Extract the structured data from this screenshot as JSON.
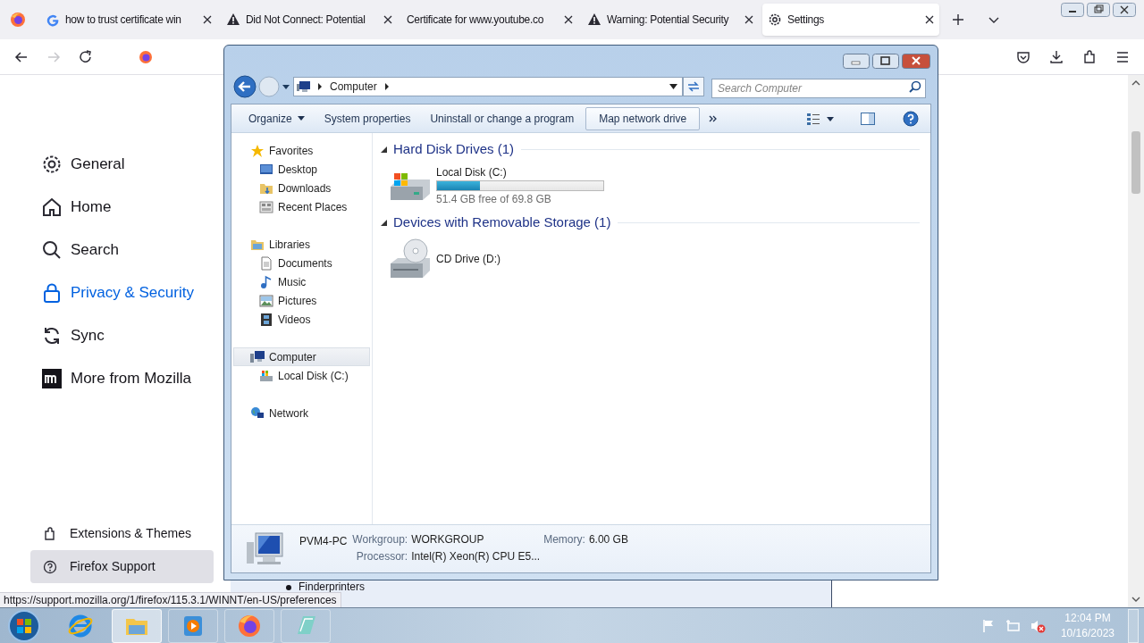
{
  "browser": {
    "tabs": [
      {
        "title": "how to trust certificate win",
        "kind": "google",
        "selected": false
      },
      {
        "title": "Did Not Connect: Potential",
        "kind": "warning",
        "selected": false
      },
      {
        "title": "Certificate for www.youtube.co",
        "kind": "plain",
        "selected": false
      },
      {
        "title": "Warning: Potential Security",
        "kind": "warning",
        "selected": false
      },
      {
        "title": "Settings",
        "kind": "gear",
        "selected": true
      }
    ],
    "nav_buttons": [
      {
        "kind": "back",
        "disabled": false
      },
      {
        "kind": "forward",
        "disabled": true
      },
      {
        "kind": "reload",
        "disabled": false
      }
    ]
  },
  "settings": {
    "categories": [
      {
        "label": "General",
        "kind": "gear",
        "selected": false
      },
      {
        "label": "Home",
        "kind": "home",
        "selected": false
      },
      {
        "label": "Search",
        "kind": "search",
        "selected": false
      },
      {
        "label": "Privacy & Security",
        "kind": "lock",
        "selected": true
      },
      {
        "label": "Sync",
        "kind": "sync",
        "selected": false
      },
      {
        "label": "More from Mozilla",
        "kind": "mozilla",
        "selected": false
      }
    ],
    "footer_links": [
      {
        "label": "Extensions & Themes",
        "kind": "puzzle",
        "hovered": false
      },
      {
        "label": "Firefox Support",
        "kind": "help",
        "hovered": true
      }
    ],
    "page_behind": {
      "bullet": "Finderprinters"
    }
  },
  "status_url": "https://support.mozilla.org/1/firefox/115.3.1/WINNT/en-US/preferences",
  "explorer": {
    "address": "Computer",
    "search_placeholder": "Search Computer",
    "toolbar": [
      {
        "label": "Organize",
        "has_menu": true,
        "hovered": false
      },
      {
        "label": "System properties",
        "has_menu": false,
        "hovered": false
      },
      {
        "label": "Uninstall or change a program",
        "has_menu": false,
        "hovered": false
      },
      {
        "label": "Map network drive",
        "has_menu": false,
        "hovered": true
      }
    ],
    "nav_tree": [
      {
        "label": "Favorites",
        "kind": "star",
        "selected": false,
        "children": [
          {
            "label": "Desktop",
            "kind": "desktop",
            "selected": false
          },
          {
            "label": "Downloads",
            "kind": "downloads",
            "selected": false
          },
          {
            "label": "Recent Places",
            "kind": "recent",
            "selected": false
          }
        ]
      },
      {
        "label": "Libraries",
        "kind": "libraries",
        "selected": false,
        "children": [
          {
            "label": "Documents",
            "kind": "document",
            "selected": false
          },
          {
            "label": "Music",
            "kind": "music",
            "selected": false
          },
          {
            "label": "Pictures",
            "kind": "pictures",
            "selected": false
          },
          {
            "label": "Videos",
            "kind": "videos",
            "selected": false
          }
        ]
      },
      {
        "label": "Computer",
        "kind": "computer",
        "selected": true,
        "children": [
          {
            "label": "Local Disk (C:)",
            "kind": "disk",
            "selected": false
          }
        ]
      },
      {
        "label": "Network",
        "kind": "network",
        "selected": false
      }
    ],
    "sections": [
      {
        "title": "Hard Disk Drives (1)",
        "items": [
          {
            "kind": "disk",
            "name": "Local Disk (C:)",
            "level": 0.26,
            "detail": "51.4 GB free of 69.8 GB"
          }
        ]
      },
      {
        "title": "Devices with Removable Storage (1)",
        "items": [
          {
            "kind": "cd",
            "name": "CD Drive (D:)"
          }
        ]
      }
    ],
    "details": {
      "name": "PVM4-PC",
      "fields": [
        {
          "label": "Workgroup:",
          "value": "WORKGROUP"
        },
        {
          "label": "Memory:",
          "value": "6.00 GB"
        },
        {
          "label": "Processor:",
          "value": "Intel(R) Xeon(R) CPU E5..."
        }
      ]
    }
  },
  "taskbar": {
    "apps": [
      {
        "kind": "ie",
        "active": false
      },
      {
        "kind": "explorer",
        "active": true
      },
      {
        "kind": "media",
        "active": false
      },
      {
        "kind": "firefox",
        "active": false
      },
      {
        "kind": "notepad",
        "active": false
      }
    ],
    "time": "12:04 PM",
    "date": "10/16/2023"
  }
}
